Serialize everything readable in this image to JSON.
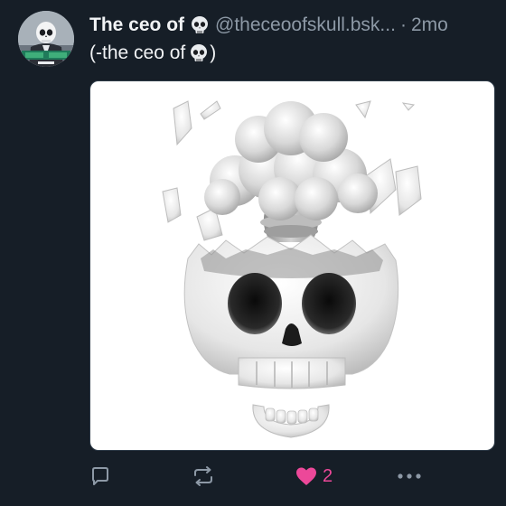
{
  "post": {
    "display_name": "The ceo of",
    "handle": "@theceoofskull.bsk...",
    "separator": "·",
    "time": "2mo",
    "text_before": "(-the ceo of",
    "text_after": ")"
  },
  "actions": {
    "reply_icon": "reply-icon",
    "repost_icon": "repost-icon",
    "like_icon": "heart-icon",
    "like_count": "2",
    "more_icon": "more-icon"
  },
  "colors": {
    "background": "#161e27",
    "secondary_text": "#8d99a6",
    "like_accent": "#ec4899"
  }
}
